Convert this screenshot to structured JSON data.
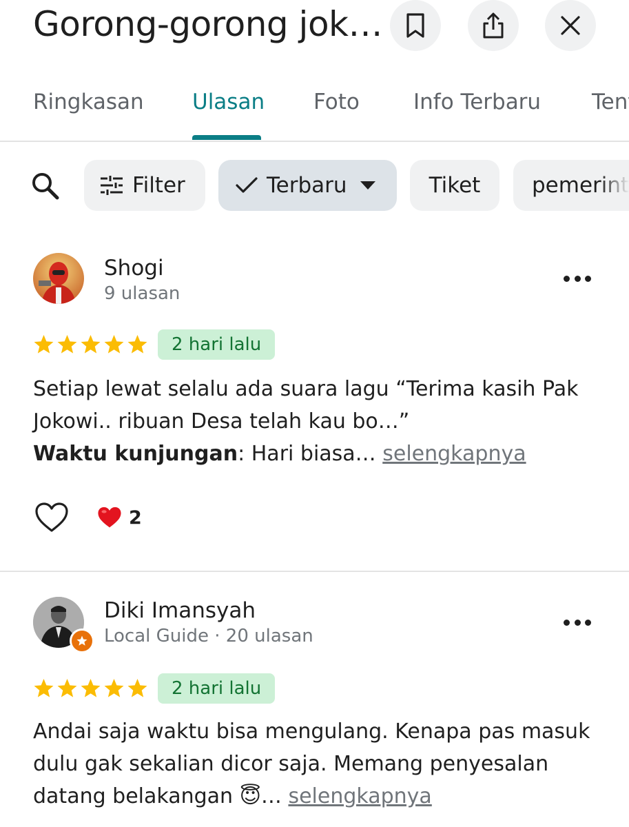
{
  "header": {
    "title": "Gorong-gorong jok…",
    "icons": [
      "bookmark-icon",
      "share-icon",
      "close-icon"
    ]
  },
  "tabs": [
    {
      "label": "Ringkasan",
      "active": false
    },
    {
      "label": "Ulasan",
      "active": true
    },
    {
      "label": "Foto",
      "active": false
    },
    {
      "label": "Info Terbaru",
      "active": false
    },
    {
      "label": "Tent",
      "active": false
    }
  ],
  "chips": {
    "filter": "Filter",
    "sort": "Terbaru",
    "tiket": "Tiket",
    "pemerintah": "pemerint"
  },
  "colors": {
    "accent": "#0b7e86",
    "star": "#fbbc04",
    "badge_bg": "#ccf0d6",
    "badge_text": "#137333",
    "guide_badge": "#e8710a"
  },
  "reviews": [
    {
      "name": "Shogi",
      "meta": "9 ulasan",
      "rating": 5,
      "date": "2 hari lalu",
      "text": "Setiap lewat selalu ada suara lagu “Terima kasih Pak Jokowi.. ribuan Desa telah kau bo…”",
      "visit_label": "Waktu kunjungan",
      "visit_value": ": Hari biasa…",
      "more": "selengkapnya",
      "reaction_count": "2"
    },
    {
      "name": "Diki Imansyah",
      "meta": "Local Guide · 20 ulasan",
      "rating": 5,
      "date": "2 hari lalu",
      "text": "Andai saja waktu bisa mengulang. Kenapa pas masuk dulu gak sekalian dicor saja. Memang penyesalan datang belakangan 😇…",
      "more": "selengkapnya"
    }
  ]
}
